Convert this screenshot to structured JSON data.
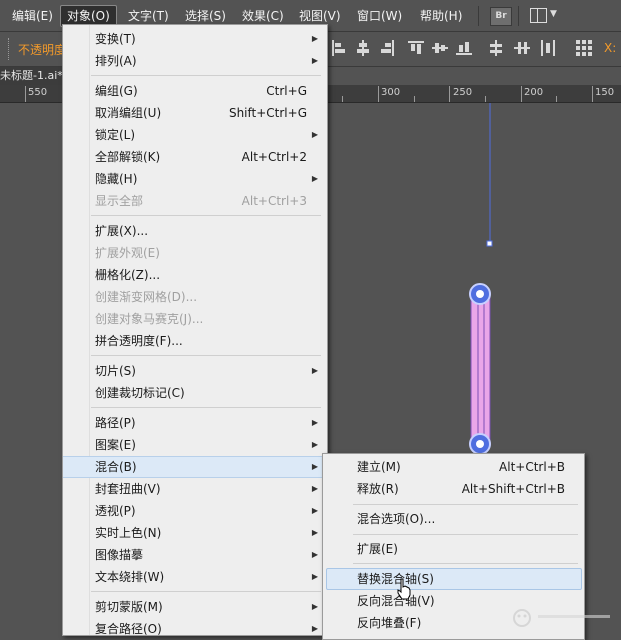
{
  "menubar": {
    "items": [
      "编辑(E)",
      "对象(O)",
      "文字(T)",
      "选择(S)",
      "效果(C)",
      "视图(V)",
      "窗口(W)",
      "帮助(H)"
    ],
    "active_index": 1,
    "bridge_label": "Br"
  },
  "controlbar": {
    "opacity_label": "不透明度",
    "x_label": "X:"
  },
  "document": {
    "tab_title": "未标题-1.ai*"
  },
  "ruler": {
    "labels": [
      "550",
      "300",
      "250",
      "200",
      "150"
    ]
  },
  "object_menu": {
    "items": [
      {
        "label": "变换(T)",
        "shortcut": "",
        "submenu": true,
        "disabled": false
      },
      {
        "label": "排列(A)",
        "shortcut": "",
        "submenu": true,
        "disabled": false
      },
      {
        "label": "编组(G)",
        "shortcut": "Ctrl+G",
        "submenu": false,
        "disabled": false
      },
      {
        "label": "取消编组(U)",
        "shortcut": "Shift+Ctrl+G",
        "submenu": false,
        "disabled": false
      },
      {
        "label": "锁定(L)",
        "shortcut": "",
        "submenu": true,
        "disabled": false
      },
      {
        "label": "全部解锁(K)",
        "shortcut": "Alt+Ctrl+2",
        "submenu": false,
        "disabled": false
      },
      {
        "label": "隐藏(H)",
        "shortcut": "",
        "submenu": true,
        "disabled": false
      },
      {
        "label": "显示全部",
        "shortcut": "Alt+Ctrl+3",
        "submenu": false,
        "disabled": true
      },
      {
        "label": "扩展(X)...",
        "shortcut": "",
        "submenu": false,
        "disabled": false
      },
      {
        "label": "扩展外观(E)",
        "shortcut": "",
        "submenu": false,
        "disabled": true
      },
      {
        "label": "栅格化(Z)...",
        "shortcut": "",
        "submenu": false,
        "disabled": false
      },
      {
        "label": "创建渐变网格(D)...",
        "shortcut": "",
        "submenu": false,
        "disabled": true
      },
      {
        "label": "创建对象马赛克(J)...",
        "shortcut": "",
        "submenu": false,
        "disabled": true
      },
      {
        "label": "拼合透明度(F)...",
        "shortcut": "",
        "submenu": false,
        "disabled": false
      },
      {
        "label": "切片(S)",
        "shortcut": "",
        "submenu": true,
        "disabled": false
      },
      {
        "label": "创建裁切标记(C)",
        "shortcut": "",
        "submenu": false,
        "disabled": false
      },
      {
        "label": "路径(P)",
        "shortcut": "",
        "submenu": true,
        "disabled": false
      },
      {
        "label": "图案(E)",
        "shortcut": "",
        "submenu": true,
        "disabled": false
      },
      {
        "label": "混合(B)",
        "shortcut": "",
        "submenu": true,
        "disabled": false
      },
      {
        "label": "封套扭曲(V)",
        "shortcut": "",
        "submenu": true,
        "disabled": false
      },
      {
        "label": "透视(P)",
        "shortcut": "",
        "submenu": true,
        "disabled": false
      },
      {
        "label": "实时上色(N)",
        "shortcut": "",
        "submenu": true,
        "disabled": false
      },
      {
        "label": "图像描摹",
        "shortcut": "",
        "submenu": true,
        "disabled": false
      },
      {
        "label": "文本绕排(W)",
        "shortcut": "",
        "submenu": true,
        "disabled": false
      },
      {
        "label": "剪切蒙版(M)",
        "shortcut": "",
        "submenu": true,
        "disabled": false
      },
      {
        "label": "复合路径(O)",
        "shortcut": "",
        "submenu": true,
        "disabled": false
      }
    ],
    "highlighted_index": 18
  },
  "blend_submenu": {
    "items": [
      {
        "label": "建立(M)",
        "shortcut": "Alt+Ctrl+B"
      },
      {
        "label": "释放(R)",
        "shortcut": "Alt+Shift+Ctrl+B"
      },
      {
        "label": "混合选项(O)...",
        "shortcut": ""
      },
      {
        "label": "扩展(E)",
        "shortcut": ""
      },
      {
        "label": "替换混合轴(S)",
        "shortcut": ""
      },
      {
        "label": "反向混合轴(V)",
        "shortcut": ""
      },
      {
        "label": "反向堆叠(F)",
        "shortcut": ""
      }
    ],
    "highlighted_index": 4
  },
  "colors": {
    "ui_bg": "#535353",
    "menu_bg": "#eeeeee",
    "highlight": "#dce9f7",
    "orange_label": "#f29a2b",
    "anchor_blue": "#4f6ee0",
    "blend_pink": "#e9a6e9"
  }
}
